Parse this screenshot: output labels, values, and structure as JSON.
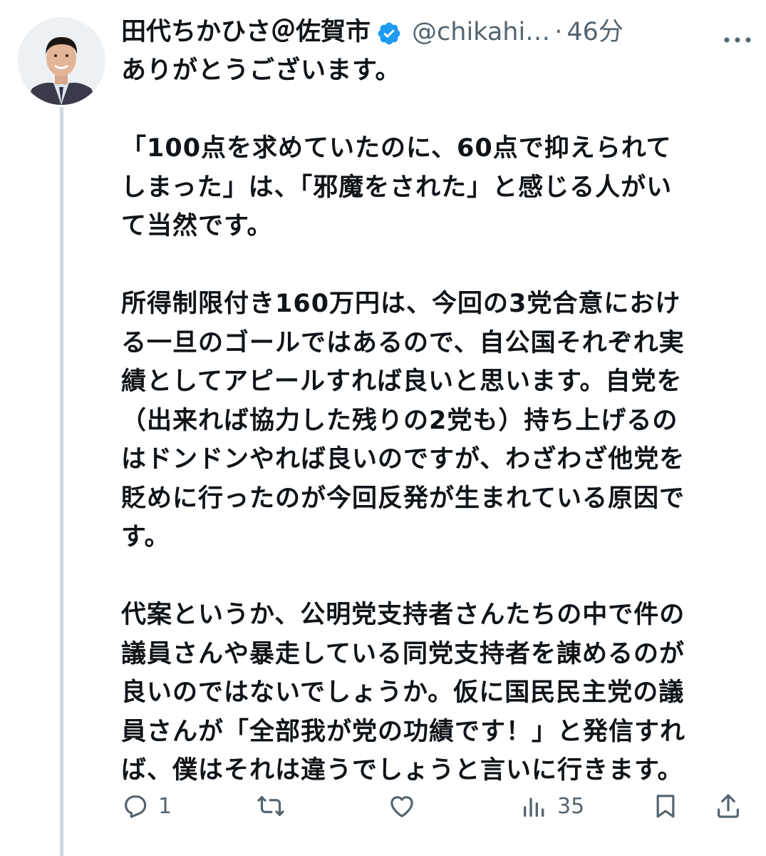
{
  "tweet": {
    "author": {
      "display_name": "田代ちかひさ＠佐賀市",
      "handle": "@chikahi…",
      "separator": "·",
      "time": "46分"
    },
    "paragraphs": [
      "ありがとうございます。",
      "",
      "「100点を求めていたのに、60点で抑えられて\nしまった」は、「邪魔をされた」と感じる人がい\nて当然です。",
      "",
      "所得制限付き160万円は、今回の3党合意におけ\nる一旦のゴールではあるので、自公国それぞれ実\n績としてアピールすれば良いと思います。自党を\n（出来れば協力した残りの2党も）持ち上げるの\nはドンドンやれば良いのですが、わざわざ他党を\n貶めに行ったのが今回反発が生まれている原因で\nす。",
      "",
      "代案というか、公明党支持者さんたちの中で件の\n議員さんや暴走している同党支持者を諌めるのが\n良いのではないでしょうか。仮に国民民主党の議\n員さんが「全部我が党の功績です！」と発信すれ\nば、僕はそれは違うでしょうと言いに行きます。"
    ],
    "actions": {
      "reply": {
        "icon": "reply-icon",
        "count": "1"
      },
      "retweet": {
        "icon": "retweet-icon",
        "count": ""
      },
      "like": {
        "icon": "like-icon",
        "count": ""
      },
      "views": {
        "icon": "views-icon",
        "count": "35"
      },
      "bookmark": {
        "icon": "bookmark-icon"
      },
      "share": {
        "icon": "share-icon"
      }
    }
  },
  "colors": {
    "text": "#0f1419",
    "secondary": "#536471",
    "verified": "#1d9bf0",
    "thread_line": "#cfd9de"
  }
}
